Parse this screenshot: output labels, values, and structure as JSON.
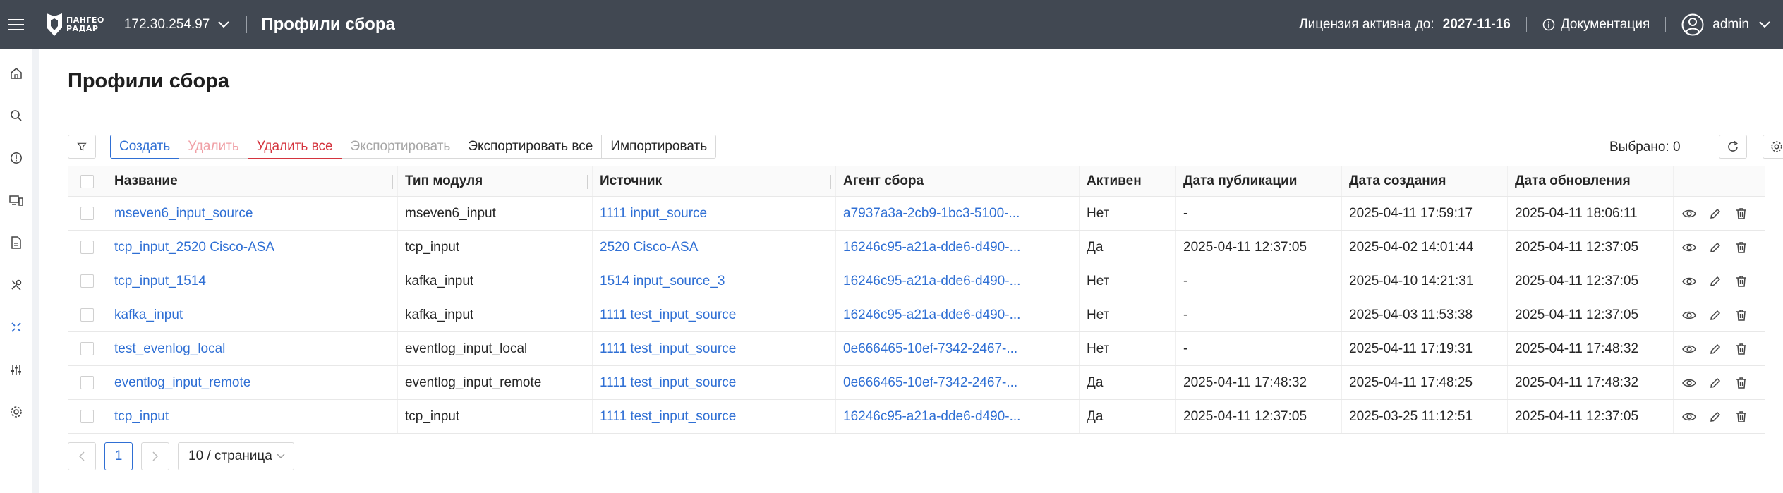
{
  "header": {
    "logo_line1": "ПАНГЕО",
    "logo_line2": "РАДАР",
    "ip": "172.30.254.97",
    "title": "Профили сбора",
    "license_label": "Лицензия активна до:",
    "license_date": "2027-11-16",
    "docs_label": "Документация",
    "user": "admin"
  },
  "page": {
    "title": "Профили сбора"
  },
  "toolbar": {
    "create": "Создать",
    "delete": "Удалить",
    "delete_all": "Удалить все",
    "export": "Экспортировать",
    "export_all": "Экспортировать все",
    "import": "Импортировать",
    "selected": "Выбрано: 0"
  },
  "table": {
    "columns": [
      "Название",
      "Тип модуля",
      "Источник",
      "Агент сбора",
      "Активен",
      "Дата публикации",
      "Дата создания",
      "Дата обновления"
    ],
    "rows": [
      [
        "mseven6_input_source",
        "mseven6_input",
        "1111 input_source",
        "a7937a3a-2cb9-1bc3-5100-...",
        "Нет",
        "-",
        "2025-04-11 17:59:17",
        "2025-04-11 18:06:11"
      ],
      [
        "tcp_input_2520 Cisco-ASA",
        "tcp_input",
        "2520 Cisco-ASA",
        "16246c95-a21a-dde6-d490-...",
        "Да",
        "2025-04-11 12:37:05",
        "2025-04-02 14:01:44",
        "2025-04-11 12:37:05"
      ],
      [
        "tcp_input_1514",
        "kafka_input",
        "1514 input_source_3",
        "16246c95-a21a-dde6-d490-...",
        "Нет",
        "-",
        "2025-04-10 14:21:31",
        "2025-04-11 12:37:05"
      ],
      [
        "kafka_input",
        "kafka_input",
        "1111 test_input_source",
        "16246c95-a21a-dde6-d490-...",
        "Нет",
        "-",
        "2025-04-03 11:53:38",
        "2025-04-11 12:37:05"
      ],
      [
        "test_evenlog_local",
        "eventlog_input_local",
        "1111 test_input_source",
        "0e666465-10ef-7342-2467-...",
        "Нет",
        "-",
        "2025-04-11 17:19:31",
        "2025-04-11 17:48:32"
      ],
      [
        "eventlog_input_remote",
        "eventlog_input_remote",
        "1111 test_input_source",
        "0e666465-10ef-7342-2467-...",
        "Да",
        "2025-04-11 17:48:32",
        "2025-04-11 17:48:25",
        "2025-04-11 17:48:32"
      ],
      [
        "tcp_input",
        "tcp_input",
        "1111 test_input_source",
        "16246c95-a21a-dde6-d490-...",
        "Да",
        "2025-04-11 12:37:05",
        "2025-03-25 11:12:51",
        "2025-04-11 12:37:05"
      ]
    ]
  },
  "pagination": {
    "current": "1",
    "page_size": "10 / страница"
  },
  "colors": {
    "header_bg": "#414852",
    "link": "#2f6fd4",
    "danger": "#d4343e"
  }
}
